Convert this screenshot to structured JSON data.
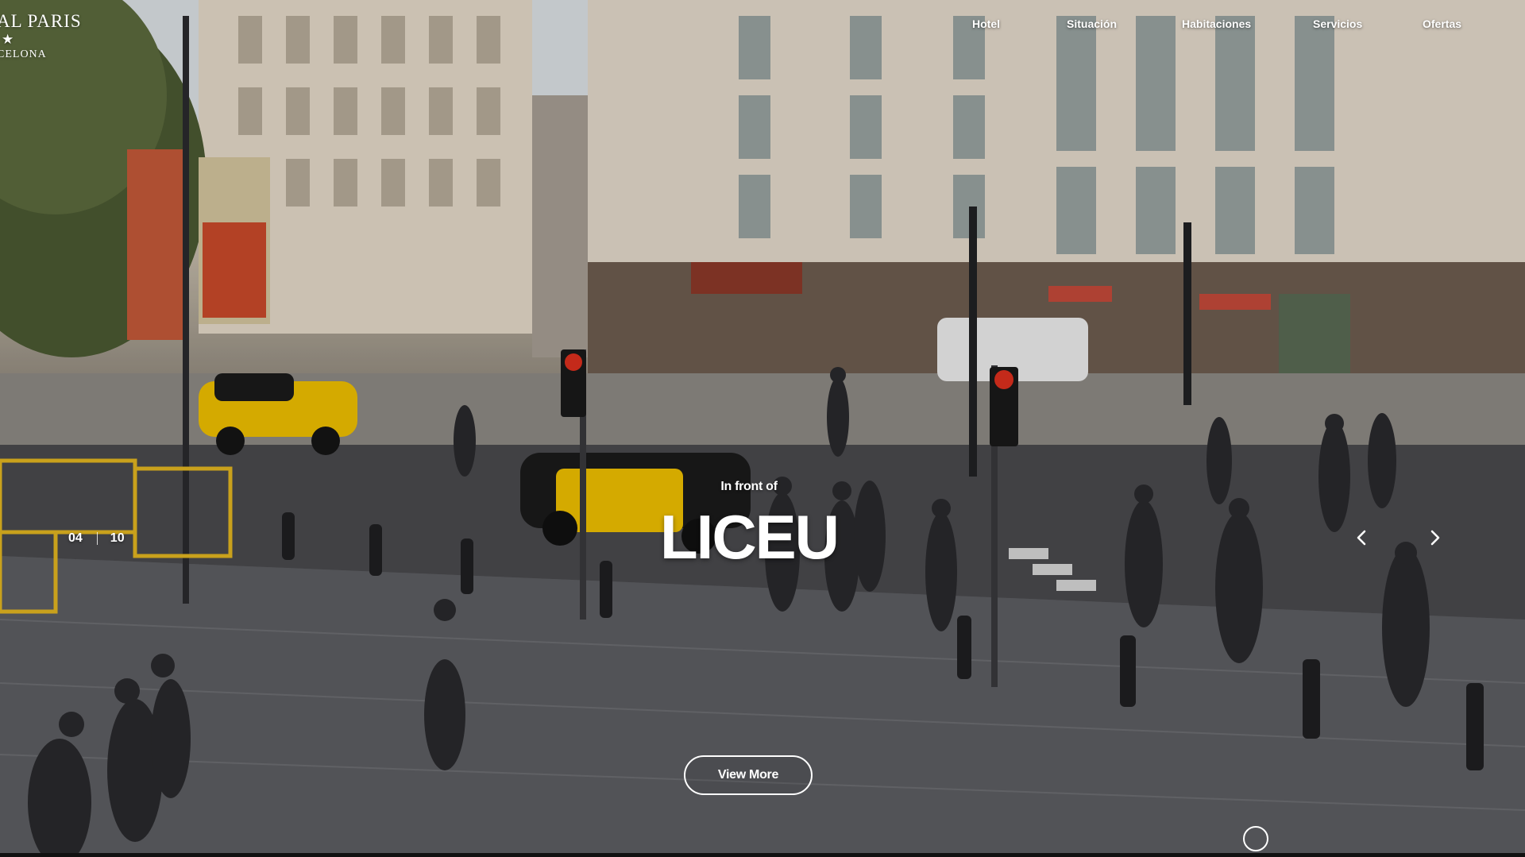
{
  "brand": {
    "name": "AL PARIS",
    "star": "★",
    "city": "CELONA"
  },
  "nav": {
    "items": [
      {
        "label": "Hotel"
      },
      {
        "label": "Situación"
      },
      {
        "label": "Habitaciones"
      },
      {
        "label": "Servicios"
      },
      {
        "label": "Ofertas"
      }
    ]
  },
  "slide": {
    "subtitle": "In front of",
    "title": "LICEU",
    "cta_label": "View More",
    "current": "04",
    "total": "10"
  },
  "icons": {
    "prev": "chevron-left-icon",
    "next": "chevron-right-icon",
    "scroll": "scroll-down-circle-icon"
  },
  "colors": {
    "text": "#ffffff",
    "taxi_yellow": "#f2c200",
    "taxi_black": "#1b1b1b"
  }
}
